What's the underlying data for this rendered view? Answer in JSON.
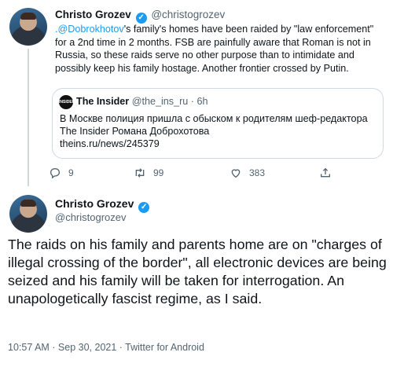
{
  "tweet1": {
    "name": "Christo Grozev",
    "handle": "@christogrozev",
    "mention": ".@Dobrokhotov",
    "text_rest": "'s family's homes have been raided by \"law enforcement\" for a 2nd time in 2 months. FSB are painfully aware that Roman is not in Russia, so these raids serve no other purpose than to intimidate and possibly keep his family hostage. Another frontier crossed by Putin.",
    "quote": {
      "logo_text": "INSIDER",
      "name": "The Insider",
      "handle_time": "@the_ins_ru · 6h",
      "text_line1": "В Москве полиция пришла с обыском к родителям шеф-редактора",
      "text_line2": "The Insider Романа Доброхотова",
      "link": "theins.ru/news/245379"
    },
    "actions": {
      "reply_icon": "reply-icon",
      "reply_count": "9",
      "retweet_icon": "retweet-icon",
      "retweet_count": "99",
      "like_icon": "heart-icon",
      "like_count": "383",
      "share_icon": "share-icon"
    }
  },
  "tweet2": {
    "name": "Christo Grozev",
    "handle": "@christogrozev",
    "text": "The raids on his family and parents home are on \"charges of illegal crossing of the border\", all electronic devices are being seized and his family will be taken for interrogation.  An unapologetically fascist regime, as I said.",
    "meta": "10:57 AM · Sep 30, 2021 · Twitter for Android"
  },
  "colors": {
    "accent": "#1d9bf0",
    "muted": "#536471",
    "border": "#cfd9de"
  }
}
